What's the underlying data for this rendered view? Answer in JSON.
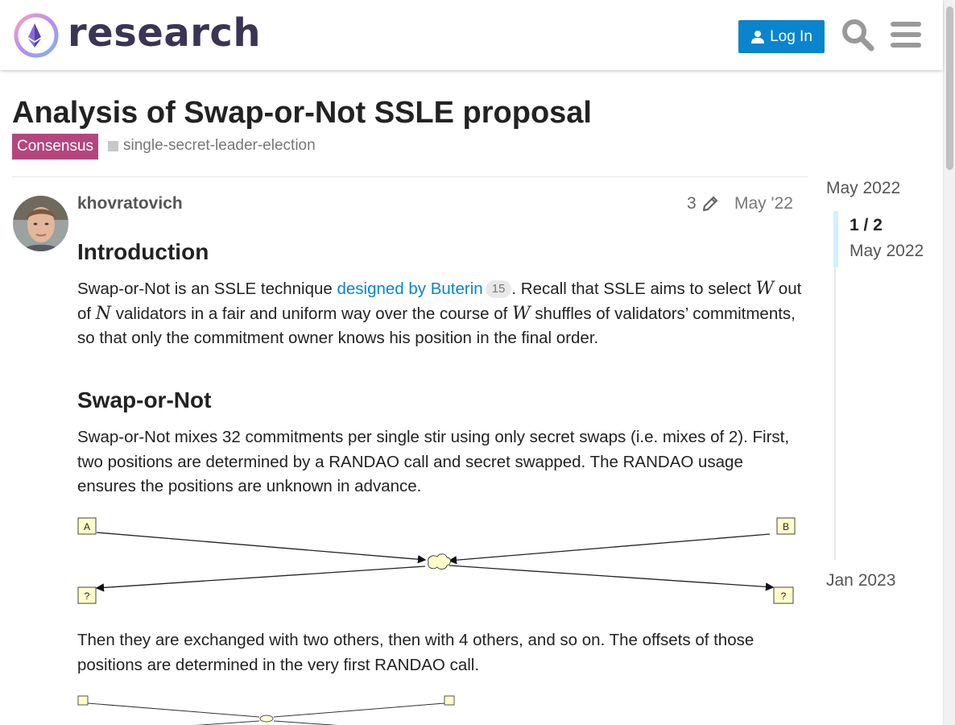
{
  "header": {
    "site_name": "research",
    "login_label": "Log In"
  },
  "topic": {
    "title": "Analysis of Swap-or-Not SSLE proposal",
    "category": "Consensus",
    "category_color": "#b3467e",
    "tag": "single-secret-leader-election"
  },
  "post": {
    "author": "khovratovich",
    "edit_count": "3",
    "date": "May '22",
    "intro_heading": "Introduction",
    "intro": {
      "t1": "Swap-or-Not is an SSLE technique ",
      "link": "designed by Buterin",
      "link_clicks": "15",
      "t2": ". Recall that SSLE aims to select ",
      "m1": "W",
      "t3": " out of ",
      "m2": "N",
      "t4": " validators in a fair and uniform way over the course of ",
      "m3": "W",
      "t5": " shuffles of validators’ commitments, so that only the commitment owner knows his position in the final order."
    },
    "swap_heading": "Swap-or-Not",
    "swap_paragraph": "Swap-or-Not mixes 32 commitments per single stir using only secret swaps (i.e. mixes of 2). First, two positions are determined by a RANDAO call and secret swapped. The RANDAO usage ensures the positions are unknown in advance.",
    "diagram1_labels": {
      "top_left": "A",
      "top_right": "B",
      "bottom_left": "?",
      "bottom_right": "?"
    },
    "then_paragraph": "Then they are exchanged with two others, then with 4 others, and so on. The offsets of those positions are determined in the very first RANDAO call."
  },
  "timeline": {
    "start": "May 2022",
    "position": "1 / 2",
    "position_date": "May 2022",
    "end": "Jan 2023"
  },
  "colors": {
    "accent": "#0a84cc",
    "category": "#b3467e"
  }
}
